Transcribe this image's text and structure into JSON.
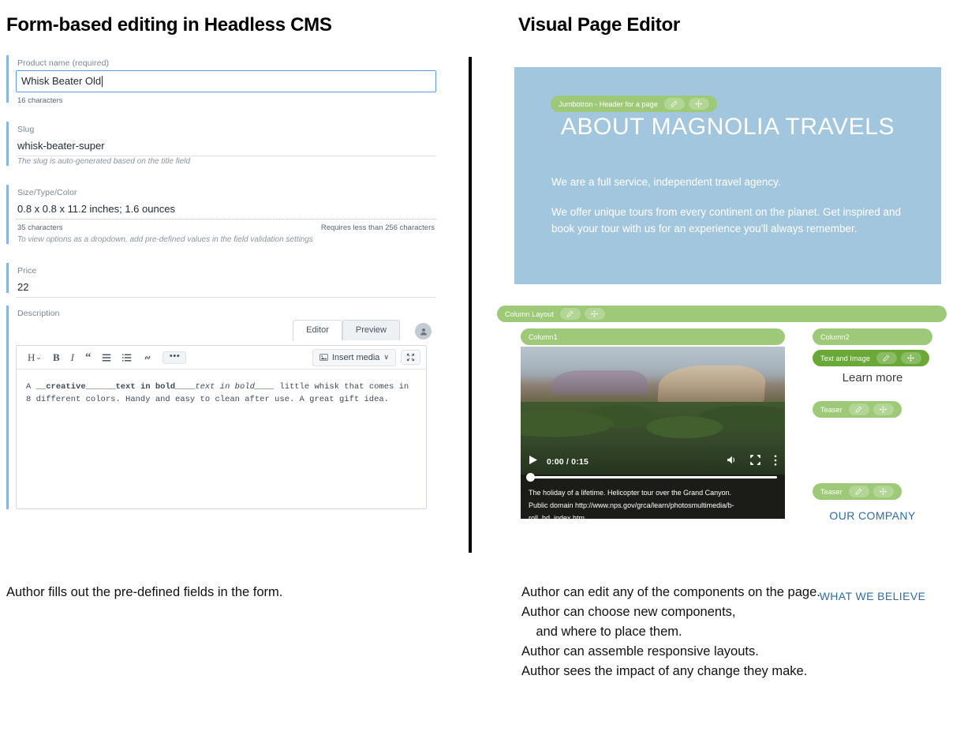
{
  "left": {
    "title": "Form-based editing in Headless CMS",
    "caption": "Author fills out the pre-defined fields in the form.",
    "fields": {
      "product_name": {
        "label": "Product name (required)",
        "value": "Whisk Beater Old",
        "counter": "16 characters"
      },
      "slug": {
        "label": "Slug",
        "value": "whisk-beater-super",
        "hint": "The slug is auto-generated based on the title field"
      },
      "size_type_color": {
        "label": "Size/Type/Color",
        "value": "0.8 x 0.8 x 11.2 inches; 1.6 ounces",
        "counter": "35 characters",
        "requirement": "Requires less than 256 characters",
        "hint": "To view options as a dropdown, add pre-defined values in the field validation settings"
      },
      "price": {
        "label": "Price",
        "value": "22"
      },
      "description": {
        "label": "Description",
        "tabs": [
          {
            "label": "Editor",
            "active": true
          },
          {
            "label": "Preview",
            "active": false
          }
        ],
        "toolbar": {
          "heading": "H",
          "heading_caret": "⌄",
          "bold": "B",
          "italic": "I",
          "quote": "“",
          "bullet_list": "bullet-list-icon",
          "ordered_list": "ordered-list-icon",
          "link": "link-icon",
          "more": "•••",
          "insert_media": "Insert media",
          "insert_media_caret": "∨",
          "expand": "expand-icon"
        },
        "body_line1_a": "A ",
        "body_line1_b": "__creative______",
        "body_line1_c": "text in bold____",
        "body_line1_d": "text in bold____",
        "body_line1_e": " little whisk that comes in",
        "body_line2": "8 different colors. Handy and easy to clean after use. A great gift idea."
      }
    }
  },
  "right": {
    "title": "Visual Page Editor",
    "caption": "Author can edit any of the components on the page.\nAuthor can choose new components,\n    and where to place them.\nAuthor can assemble responsive layouts.\nAuthor sees the impact of any change they make.",
    "jumbotron": {
      "chip_label": "Jumbotron - Header for a page",
      "heading": "ABOUT MAGNOLIA TRAVELS",
      "paragraph1": "We are a full service, independent travel agency.",
      "paragraph2": "We offer unique tours from every continent on the planet. Get inspired and book your tour with us for an experience you'll always remember.",
      "background_color": "#a2c6dd"
    },
    "components": {
      "column_layout": "Column Layout",
      "column1": "Column1",
      "column2": "Column2",
      "text_and_image": "Text and Image",
      "teaser1": "Teaser",
      "teaser2": "Teaser"
    },
    "right_column_texts": {
      "learn_more": "Learn more",
      "our_company": "OUR COMPANY",
      "what_we_believe": "WHAT WE BELIEVE"
    },
    "video": {
      "time": "0:00 / 0:15",
      "caption_line1": "The holiday of a lifetime. Helicopter tour over the Grand Canyon.",
      "caption_line2": "Public domain http://www.nps.gov/grca/learn/photosmultimedia/b-roll_hd_index.htm"
    },
    "colors": {
      "chip_green": "#9ec978",
      "chip_green_dark": "#6aa938",
      "link_blue": "#2e6da4"
    }
  }
}
